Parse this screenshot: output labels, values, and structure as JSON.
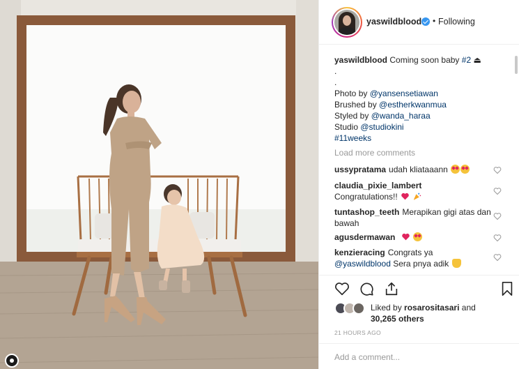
{
  "post": {
    "username": "yaswildblood",
    "follow_status": "Following",
    "separator": "•"
  },
  "caption": {
    "username": "yaswildblood",
    "line1_text": "Coming soon baby",
    "line1_tag": "#2",
    "line1_emoji": "⏏",
    "dot1": ".",
    "dot2": ".",
    "photo_prefix": "Photo by",
    "photo_handle": "@yansensetiawan",
    "brushed_prefix": "Brushed by",
    "brushed_handle": "@estherkwanmua",
    "styled_prefix": "Styled by",
    "styled_handle": "@wanda_haraa",
    "studio_prefix": "Studio",
    "studio_handle": "@studiokini",
    "tag": "#11weeks"
  },
  "load_more": "Load more comments",
  "comments": [
    {
      "user": "ussypratama",
      "text": "udah kliataaann",
      "emojis": [
        "heart-eyes-emoji",
        "heart-eyes-emoji"
      ]
    },
    {
      "user": "claudia_pixie_lambert",
      "text": "Congratulations!!",
      "emojis": [
        "red-heart-emoji",
        "party-popper-emoji"
      ]
    },
    {
      "user": "tuntashop_teeth",
      "text": "Merapikan gigi atas dan bawah",
      "emojis": []
    },
    {
      "user": "agusdermawan",
      "text": "",
      "emojis": [
        "red-heart-emoji",
        "heart-eyes-emoji"
      ]
    },
    {
      "user": "kenzieracing",
      "text": "Congrats ya",
      "mention": "@yaswildblood",
      "text2": "Sera pnya adik",
      "emojis": [
        "clapping-emoji"
      ]
    }
  ],
  "likes": {
    "prefix": "Liked by",
    "user": "rosarositasari",
    "and": "and",
    "count": "30,265 others"
  },
  "timestamp": "21 HOURS AGO",
  "add_comment": {
    "placeholder": "Add a comment..."
  },
  "colors": {
    "link": "#003569",
    "verified": "#3897f0",
    "muted": "#999999"
  },
  "icons": [
    "heart-icon",
    "comment-icon",
    "share-icon",
    "bookmark-icon",
    "verified-icon"
  ]
}
